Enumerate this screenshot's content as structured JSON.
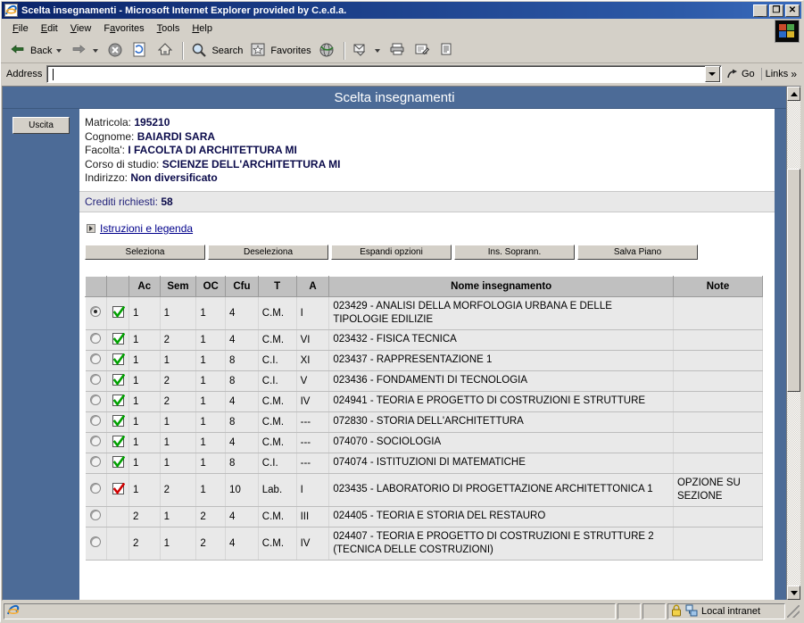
{
  "window": {
    "title": "Scelta insegnamenti - Microsoft Internet Explorer provided by C.e.d.a.",
    "icon": "ie-document-icon",
    "minimize_label": "_",
    "maximize_label": "❒",
    "close_label": "✕"
  },
  "menubar": {
    "items": [
      {
        "label": "File",
        "accel": "F"
      },
      {
        "label": "Edit",
        "accel": "E"
      },
      {
        "label": "View",
        "accel": "V"
      },
      {
        "label": "Favorites",
        "accel": "a"
      },
      {
        "label": "Tools",
        "accel": "T"
      },
      {
        "label": "Help",
        "accel": "H"
      }
    ]
  },
  "toolbar": {
    "back_label": "Back",
    "forward_label": "",
    "stop_label": "",
    "refresh_label": "",
    "home_label": "",
    "search_label": "Search",
    "favorites_label": "Favorites",
    "history_label": "",
    "mail_label": "",
    "print_label": "",
    "edit_label": "",
    "discuss_label": ""
  },
  "address": {
    "label": "Address",
    "value": "",
    "placeholder": "",
    "go_label": "Go",
    "links_label": "Links",
    "chevron": "»"
  },
  "page": {
    "header_title": "Scelta insegnamenti",
    "exit_button": "Uscita",
    "info": [
      {
        "label": "Matricola:",
        "value": "195210"
      },
      {
        "label": "Cognome:",
        "value": "BAIARDI SARA"
      },
      {
        "label": "Facolta':",
        "value": "I FACOLTA DI ARCHITETTURA MI"
      },
      {
        "label": "Corso di studio:",
        "value": "SCIENZE DELL'ARCHITETTURA MI"
      },
      {
        "label": "Indirizzo:",
        "value": "Non diversificato"
      }
    ],
    "credits_label": "Crediti richiesti:",
    "credits_value": "58",
    "instructions_link": "Istruzioni e legenda",
    "buttons": [
      "Seleziona",
      "Deseleziona",
      "Espandi opzioni",
      "Ins. Soprann.",
      "Salva Piano"
    ],
    "table": {
      "columns": [
        "",
        "",
        "Ac",
        "Sem",
        "OC",
        "Cfu",
        "T",
        "A",
        "Nome insegnamento",
        "Note"
      ],
      "rows": [
        {
          "radio": true,
          "check": "green",
          "ac": "1",
          "sem": "1",
          "oc": "1",
          "cfu": "4",
          "t": "C.M.",
          "a": "I",
          "name": "023429 - ANALISI DELLA MORFOLOGIA URBANA E DELLE TIPOLOGIE EDILIZIE",
          "note": ""
        },
        {
          "radio": false,
          "check": "green",
          "ac": "1",
          "sem": "2",
          "oc": "1",
          "cfu": "4",
          "t": "C.M.",
          "a": "VI",
          "name": "023432 - FISICA TECNICA",
          "note": ""
        },
        {
          "radio": false,
          "check": "green",
          "ac": "1",
          "sem": "1",
          "oc": "1",
          "cfu": "8",
          "t": "C.I.",
          "a": "XI",
          "name": "023437 - RAPPRESENTAZIONE 1",
          "note": ""
        },
        {
          "radio": false,
          "check": "green",
          "ac": "1",
          "sem": "2",
          "oc": "1",
          "cfu": "8",
          "t": "C.I.",
          "a": "V",
          "name": "023436 - FONDAMENTI DI TECNOLOGIA",
          "note": ""
        },
        {
          "radio": false,
          "check": "green",
          "ac": "1",
          "sem": "2",
          "oc": "1",
          "cfu": "4",
          "t": "C.M.",
          "a": "IV",
          "name": "024941 - TEORIA E PROGETTO DI COSTRUZIONI E STRUTTURE",
          "note": ""
        },
        {
          "radio": false,
          "check": "green",
          "ac": "1",
          "sem": "1",
          "oc": "1",
          "cfu": "8",
          "t": "C.M.",
          "a": "---",
          "name": "072830 - STORIA DELL'ARCHITETTURA",
          "note": ""
        },
        {
          "radio": false,
          "check": "green",
          "ac": "1",
          "sem": "1",
          "oc": "1",
          "cfu": "4",
          "t": "C.M.",
          "a": "---",
          "name": "074070 - SOCIOLOGIA",
          "note": ""
        },
        {
          "radio": false,
          "check": "green",
          "ac": "1",
          "sem": "1",
          "oc": "1",
          "cfu": "8",
          "t": "C.I.",
          "a": "---",
          "name": "074074 - ISTITUZIONI DI MATEMATICHE",
          "note": ""
        },
        {
          "radio": false,
          "check": "red",
          "ac": "1",
          "sem": "2",
          "oc": "1",
          "cfu": "10",
          "t": "Lab.",
          "a": "I",
          "name": "023435 - LABORATORIO DI PROGETTAZIONE ARCHITETTONICA 1",
          "note": "OPZIONE SU SEZIONE"
        },
        {
          "radio": false,
          "check": "none",
          "ac": "2",
          "sem": "1",
          "oc": "2",
          "cfu": "4",
          "t": "C.M.",
          "a": "III",
          "name": "024405 - TEORIA E STORIA DEL RESTAURO",
          "note": ""
        },
        {
          "radio": false,
          "check": "none",
          "ac": "2",
          "sem": "1",
          "oc": "2",
          "cfu": "4",
          "t": "C.M.",
          "a": "IV",
          "name": "024407 - TEORIA E PROGETTO DI COSTRUZIONI E STRUTTURE 2 (TECNICA DELLE COSTRUZIONI)",
          "note": ""
        }
      ]
    }
  },
  "statusbar": {
    "message": "",
    "zone_label": "Local intranet",
    "lock_icon": "padlock-icon",
    "zone_icon": "network-zone-icon",
    "page_icon": "ie-page-icon"
  },
  "colors": {
    "titlebar": "#0a246a",
    "page_header": "#4c6b97",
    "sidebar": "#4c6b97",
    "chrome": "#d4d0c8",
    "check_green": "#00a000",
    "check_red": "#d00000",
    "link": "#00008b"
  }
}
